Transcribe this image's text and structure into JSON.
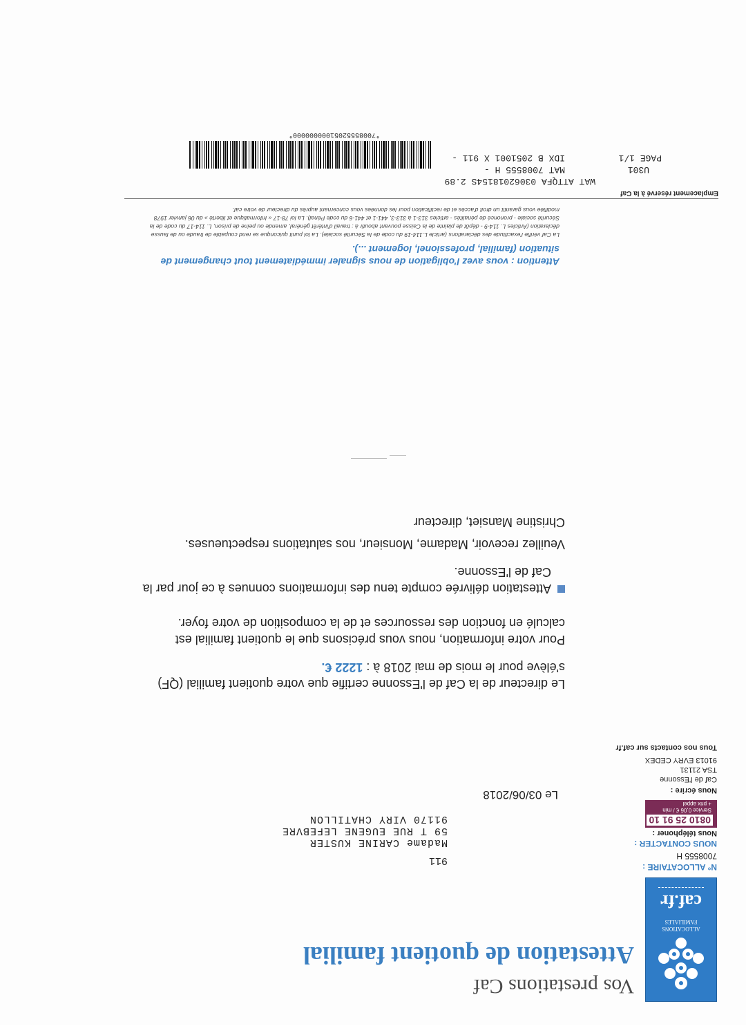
{
  "header": {
    "prestations": "Vos prestations Caf",
    "title": "Attestation de quotient familial",
    "logo": {
      "allocations_line1": "ALLOCATIONS",
      "allocations_line2": "FAMILIALES",
      "caf_mark": "caf.fr",
      "emblem_icon": "caf-emblem-icon",
      "brand_color": "#2f7cc7"
    }
  },
  "sidebar": {
    "allocataire_label": "N° ALLOCATAIRE :",
    "allocataire_number": "7008555 H",
    "contact_label": "NOUS CONTACTER :",
    "phone_label": "Nous téléphoner :",
    "phone_number": "0810 25 91 10",
    "phone_fee_line1": "Service 0,06 € / min",
    "phone_fee_line2": "+ prix appel",
    "write_label": "Nous écrire :",
    "address_lines": [
      "Caf de l'Essonne",
      "TSA 21131",
      "91013 EVRY CEDEX"
    ],
    "contacts_note": "Tous nos contacts sur caf.fr",
    "phone_color": "#7b2c56"
  },
  "addressee": {
    "code": "911",
    "lines": [
      "Madame CARINE KUSTER",
      "59 T RUE EUGENE LEFEBVRE",
      "91170 VIRY CHATILLON"
    ]
  },
  "letter": {
    "date": "Le 03/06/2018",
    "p1_text": "Le directeur de la Caf de l'Essonne certifie que votre quotient familial (QF) s'élève pour le mois de mai 2018 à : ",
    "p1_amount": "1222 €.",
    "p2": "Pour votre information, nous vous précisons que le quotient familial est calculé en fonction des ressources et de la composition de votre foyer.",
    "p3": "Attestation délivrée compte tenu des informations connues à ce jour par la Caf de l'Essonne.",
    "closing": "Veuillez recevoir, Madame, Monsieur, nos salutations respectueuses.",
    "signature": "Christine Mansiet, directeur"
  },
  "notice": {
    "attention": "Attention : vous avez l'obligation de nous signaler immédiatement tout changement de situation (familial, professionel, logement ...).",
    "legal": "La Caf vérifie l'exactitude des déclarations (article L.114-19 du code de la Sécurité sociale). La loi punit quiconque se rend coupable de fraude ou de fausse déclaration (Articles L. 114-9 - dépôt de plainte de la Caisse pouvant aboutir à : travail d'intérêt général, amende ou peine de prison, L. 114-17 du code de la Sécurité sociale - prononcé de pénalités - articles 313-1 à 313-3, 441-1 et 441-6 du code Pénal). La loi 78-17 « Informatique et liberté » du 06 janvier 1978 modifiée vous garantit un droit d'accès et de rectification pour les données vous concernant auprès du directeur de votre caf."
  },
  "reserved": {
    "label": "Emplacement réservé à la Caf",
    "line1": "WAT ATTQFA  03062018154S 2.89",
    "line2_a": "U301",
    "line2_b": "MAT 7008555 H -",
    "line3_a": "PAGE 1/1",
    "line3_b": "IDX B 2051001 X 911 -",
    "barcode_text": "*70085552051000000000*"
  }
}
